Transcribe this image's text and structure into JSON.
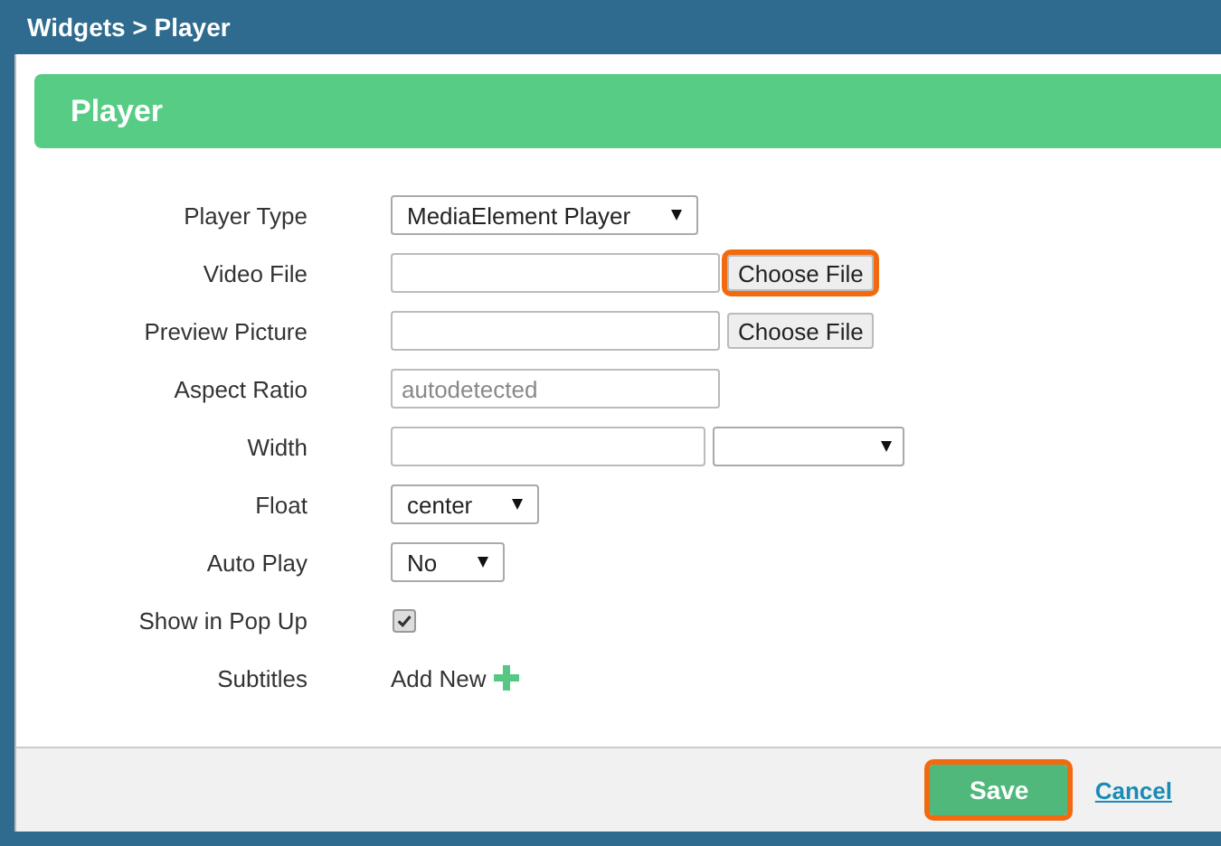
{
  "window": {
    "title": "Widgets > Player"
  },
  "panel": {
    "title": "Player"
  },
  "fields": [
    {
      "kind": "select",
      "label": "Player Type",
      "value": "MediaElement Player"
    },
    {
      "kind": "file",
      "label": "Video File",
      "button": "Choose File",
      "highlighted": true
    },
    {
      "kind": "file",
      "label": "Preview Picture",
      "button": "Choose File",
      "highlighted": false
    },
    {
      "kind": "text",
      "label": "Aspect Ratio",
      "placeholder": "autodetected"
    },
    {
      "kind": "text_select",
      "label": "Width"
    },
    {
      "kind": "select",
      "label": "Float",
      "value": "center"
    },
    {
      "kind": "select",
      "label": "Auto Play",
      "value": "No"
    },
    {
      "kind": "checkbox",
      "label": "Show in Pop Up",
      "checked": true
    },
    {
      "kind": "add",
      "label": "Subtitles",
      "text": "Add New"
    }
  ],
  "footer": {
    "save": {
      "label": "Save",
      "highlighted": true
    },
    "cancel": "Cancel"
  }
}
